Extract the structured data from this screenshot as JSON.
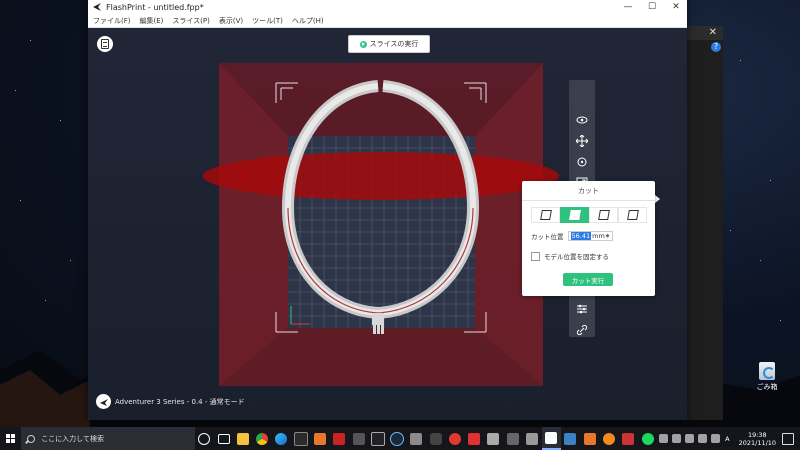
{
  "window": {
    "title": "FlashPrint - untitled.fpp*",
    "controls": [
      "—",
      "☐",
      "✕"
    ]
  },
  "menu": [
    "ファイル(F)",
    "編集(E)",
    "スライス(P)",
    "表示(V)",
    "ツール(T)",
    "ヘルプ(H)"
  ],
  "slice_button": "スライスの実行",
  "cut_panel": {
    "title": "カット",
    "modes": [
      "x-cut",
      "z-cut",
      "y-cut",
      "free-cut"
    ],
    "selected_mode": 1,
    "position_label": "カット位置",
    "position_value": "56.41",
    "position_unit": "mm",
    "fix_label": "モデル位置を固定する",
    "execute_label": "カット実行"
  },
  "toolbar_icons": [
    "view-eye",
    "move",
    "rotate",
    "scale",
    "cut",
    "add-supports",
    "hollow",
    "lay-flat",
    "mirror",
    "settings",
    "link"
  ],
  "status": {
    "printer": "Adventurer 3 Series - 0.4 - 通常モード"
  },
  "desktop": {
    "recycle_bin": "ごみ箱"
  },
  "taskbar": {
    "search_placeholder": "ここに入力して検索",
    "time": "19:38",
    "date": "2021/11/10",
    "ime": "A"
  },
  "colors": {
    "accent": "#2ec27e",
    "highlight": "#2d7be5",
    "cut_plane": "#b00000"
  }
}
